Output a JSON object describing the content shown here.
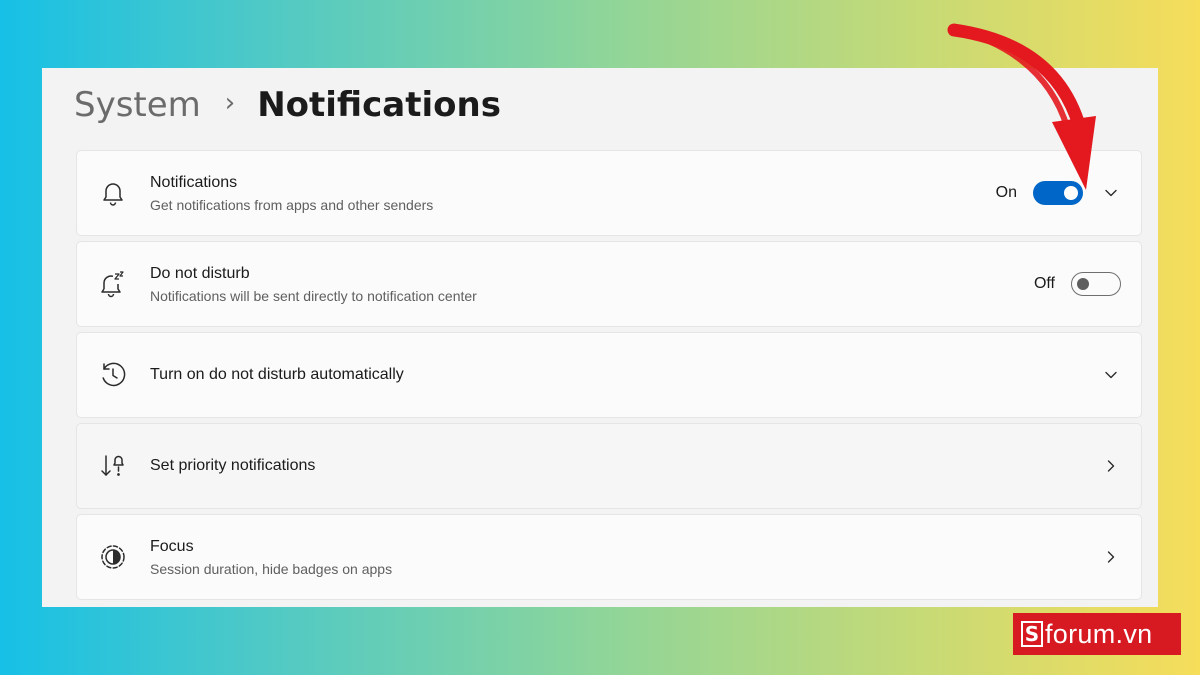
{
  "breadcrumb": {
    "parent": "System",
    "separator": "›",
    "current": "Notifications"
  },
  "settings": [
    {
      "icon": "bell-icon",
      "title": "Notifications",
      "subtitle": "Get notifications from apps and other senders",
      "state_label": "On",
      "toggle": "on",
      "trailing": "chevron-down-icon"
    },
    {
      "icon": "bell-snooze-icon",
      "title": "Do not disturb",
      "subtitle": "Notifications will be sent directly to notification center",
      "state_label": "Off",
      "toggle": "off"
    },
    {
      "icon": "clock-history-icon",
      "title": "Turn on do not disturb automatically",
      "trailing": "chevron-down-icon"
    },
    {
      "icon": "priority-sort-icon",
      "title": "Set priority notifications",
      "trailing": "chevron-right-icon"
    },
    {
      "icon": "focus-icon",
      "title": "Focus",
      "subtitle": "Session duration, hide badges on apps",
      "trailing": "chevron-right-icon"
    }
  ],
  "colors": {
    "accent": "#0066c7",
    "annotation_arrow": "#e3191f",
    "brand_logo": "#d71921"
  },
  "logo": {
    "mark": "S",
    "text": "forum.vn"
  }
}
